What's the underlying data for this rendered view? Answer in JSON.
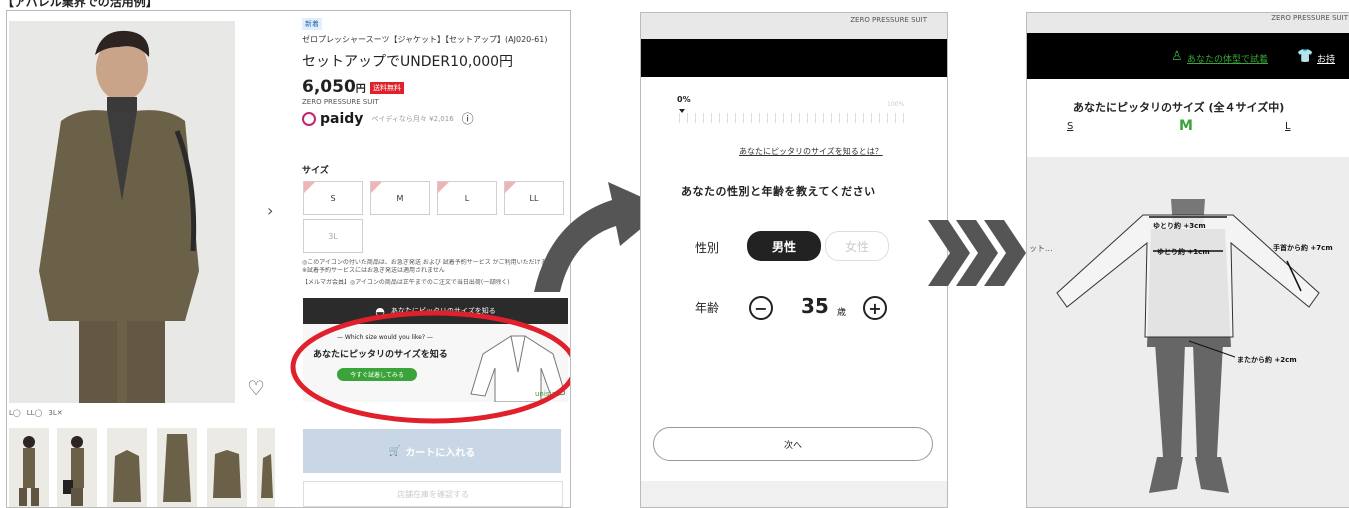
{
  "header_text": "【アパレル業界での活用例】",
  "panel1": {
    "new_badge": "新着",
    "product_code": "ゼロプレッシャースーツ【ジャケット】【セットアップ】(AJ020-61)",
    "product_title": "セットアップでUNDER10,000円",
    "price": "6,050",
    "currency": "円",
    "shipping_badge": "送料無料",
    "brand": "ZERO PRESSURE SUIT",
    "paidy_logo": "paidy",
    "paidy_text": "ペイディなら月々 ¥2,016",
    "info_icon": "ⓘ",
    "size_label": "サイズ",
    "sizes": [
      "S",
      "M",
      "L",
      "LL",
      "3L"
    ],
    "notice_line1": "◎このアイコンの付いた商品は、お急ぎ発送 および 試着予約サービス がご利用いただけます",
    "notice_line2": "※試着予約サービスにはお急ぎ発送は適用されません",
    "notice_line3": "【メルマガ会員】◎アイコンの商品は正午までのご注文で当日出荷(一部除く)",
    "banner_title": "あなたにピッタリのサイズを知る",
    "banner_sub": "— Which size would you like? —",
    "banner_main": "あなたにピッタリのサイズを知る",
    "banner_button": "今すぐ試着してみる",
    "banner_brand": "unisize",
    "cart_button": "カートに入れる",
    "store_button": "店舗在庫を確認する",
    "color_tags": [
      "L◯",
      "LL◯",
      "3L✕"
    ],
    "heart_icon": "♡",
    "next_arrow": "›"
  },
  "panel2": {
    "top_label": "ZERO PRESSURE SUIT",
    "progress_start": "0%",
    "progress_end": "100%",
    "progress_value": 0,
    "help_link": "あなたにピッタリのサイズを知るとは？",
    "question": "あなたの性別と年齢を教えてください",
    "gender_label": "性別",
    "gender_male": "男性",
    "gender_female": "女性",
    "age_label": "年齢",
    "age_value": "35",
    "age_unit": "歳",
    "minus": "−",
    "plus": "+",
    "next_button": "次へ"
  },
  "panel3": {
    "top_label": "ZERO PRESSURE SUIT",
    "try_link": "あなたの体型で試着",
    "owned_link": "お持",
    "title": "あなたにピッタリのサイズ (全４サイズ中)",
    "size_s": "S",
    "size_m": "M",
    "size_l": "L",
    "side_text": "ット...",
    "ann_chest": "ゆとり約 +3cm",
    "ann_waist": "ゆとり約 +1cm",
    "ann_wrist": "手首から約 +7cm",
    "ann_crotch": "またから約 +2cm"
  },
  "colors": {
    "accent_red": "#e0202a",
    "green": "#3aa43a",
    "link_blue": "#1d6fb8",
    "dark": "#2b2b2b"
  }
}
